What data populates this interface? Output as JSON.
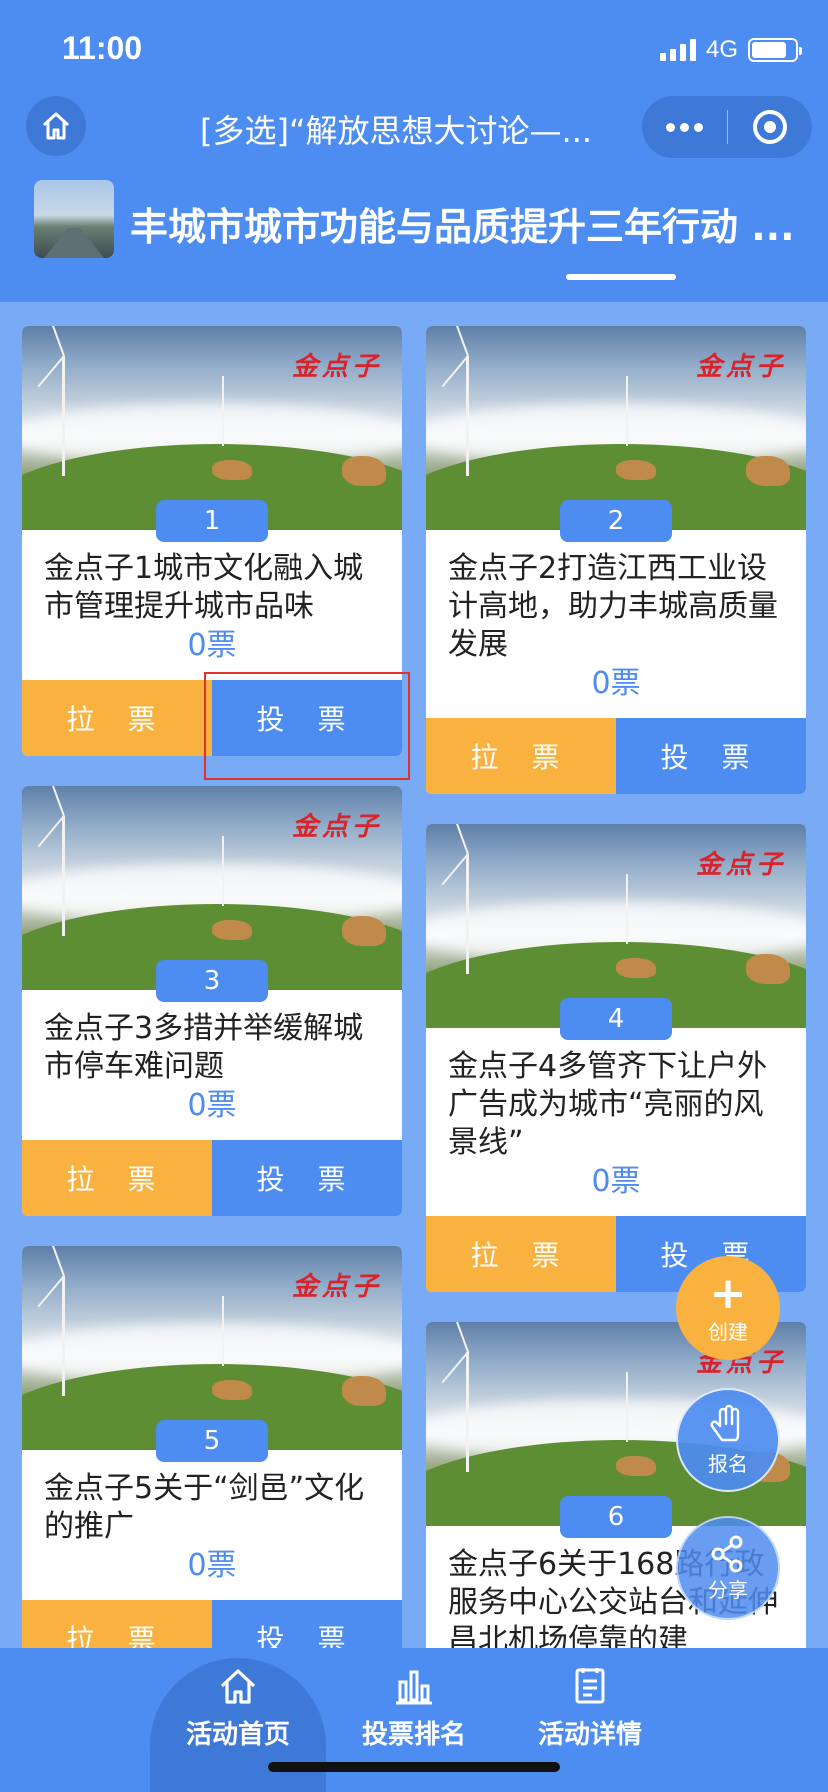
{
  "status_bar": {
    "time": "11:00",
    "network": "4G"
  },
  "nav": {
    "title": "[多选]“解放思想大讨论—..."
  },
  "activity": {
    "title": "丰城市城市功能与品质提升三年行动 ..."
  },
  "cards": [
    {
      "num": "1",
      "title": "金点子1城市文化融入城市管理提升城市品味",
      "votes": "0票",
      "pull_label": "拉 票",
      "vote_label": "投 票",
      "stamp": "金点子"
    },
    {
      "num": "2",
      "title": "金点子2打造江西工业设计高地，助力丰城高质量发展",
      "votes": "0票",
      "pull_label": "拉 票",
      "vote_label": "投 票",
      "stamp": "金点子"
    },
    {
      "num": "3",
      "title": "金点子3多措并举缓解城市停车难问题",
      "votes": "0票",
      "pull_label": "拉 票",
      "vote_label": "投 票",
      "stamp": "金点子"
    },
    {
      "num": "4",
      "title": "金点子4多管齐下让户外广告成为城市“亮丽的风景线”",
      "votes": "0票",
      "pull_label": "拉 票",
      "vote_label": "投 票",
      "stamp": "金点子"
    },
    {
      "num": "5",
      "title": "金点子5关于“剑邑”文化的推广",
      "votes": "0票",
      "pull_label": "拉 票",
      "vote_label": "投 票",
      "stamp": "金点子"
    },
    {
      "num": "6",
      "title": "金点子6关于168路行政服务中心公交站台和延伸昌北机场停靠的建",
      "votes": "",
      "pull_label": "",
      "vote_label": "",
      "stamp": "金点子"
    }
  ],
  "fabs": {
    "create": "创建",
    "signup": "报名",
    "share": "分享"
  },
  "bottom_nav": [
    {
      "label": "活动首页",
      "icon": "home-icon"
    },
    {
      "label": "投票排名",
      "icon": "bar-chart-icon"
    },
    {
      "label": "活动详情",
      "icon": "document-icon"
    }
  ],
  "colors": {
    "primary": "#4d8cf0",
    "accent": "#f9b23f",
    "background": "#78aaf5"
  }
}
